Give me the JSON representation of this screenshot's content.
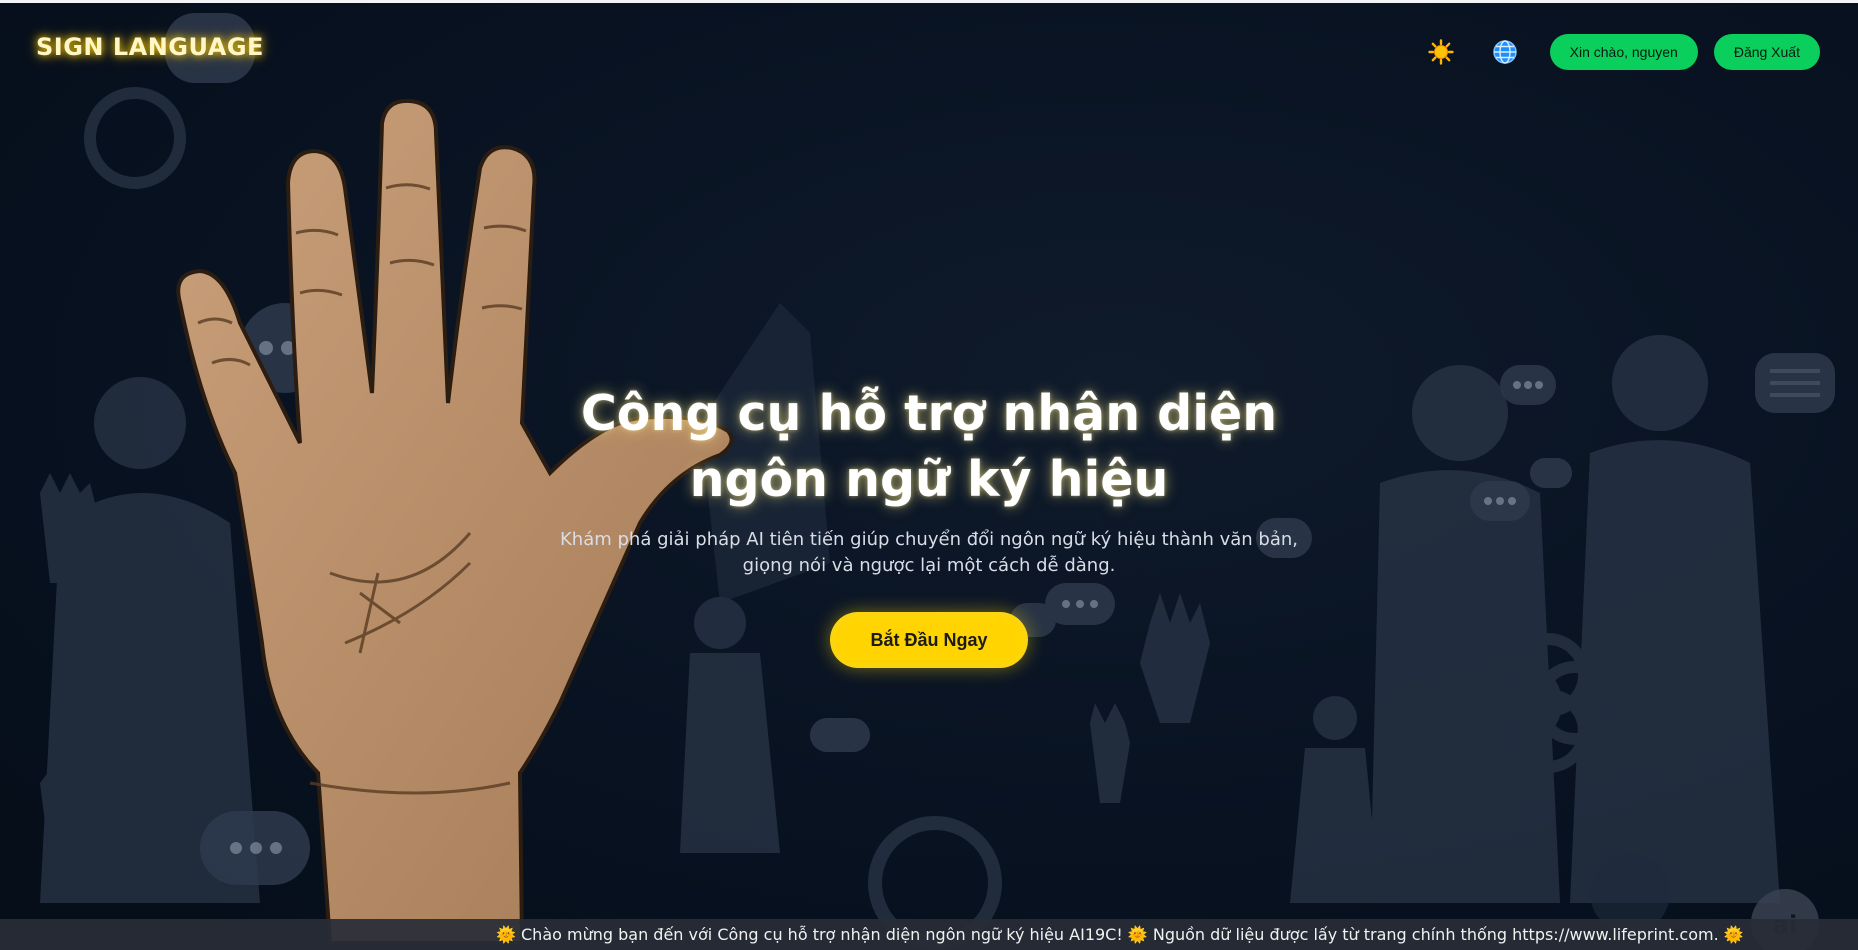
{
  "header": {
    "brand": "SIGN LANGUAGE",
    "theme_icon": "sun-icon",
    "language_icon": "globe-icon",
    "greeting_button": "Xin chào, nguyen",
    "logout_button": "Đăng Xuất"
  },
  "hero": {
    "title": "Công cụ hỗ trợ nhận diện ngôn ngữ ký hiệu",
    "subtitle": "Khám phá giải pháp AI tiên tiến giúp chuyển đổi ngôn ngữ ký hiệu thành văn bản, giọng nói và ngược lại một cách dễ dàng.",
    "cta_button": "Bắt Đầu Ngay"
  },
  "ticker": {
    "text": "🌞 Chào mừng bạn đến với Công cụ hỗ trợ nhận diện ngôn ngữ ký hiệu AI19C! 🌞 Nguồn dữ liệu được lấy từ trang chính thống https://www.lifeprint.com. 🌞"
  },
  "background": {
    "watermark_badge": "ai"
  },
  "colors": {
    "accent_yellow": "#ffd400",
    "button_green": "#0bcf5c",
    "background": "#081221",
    "skin": "#b58a64"
  }
}
